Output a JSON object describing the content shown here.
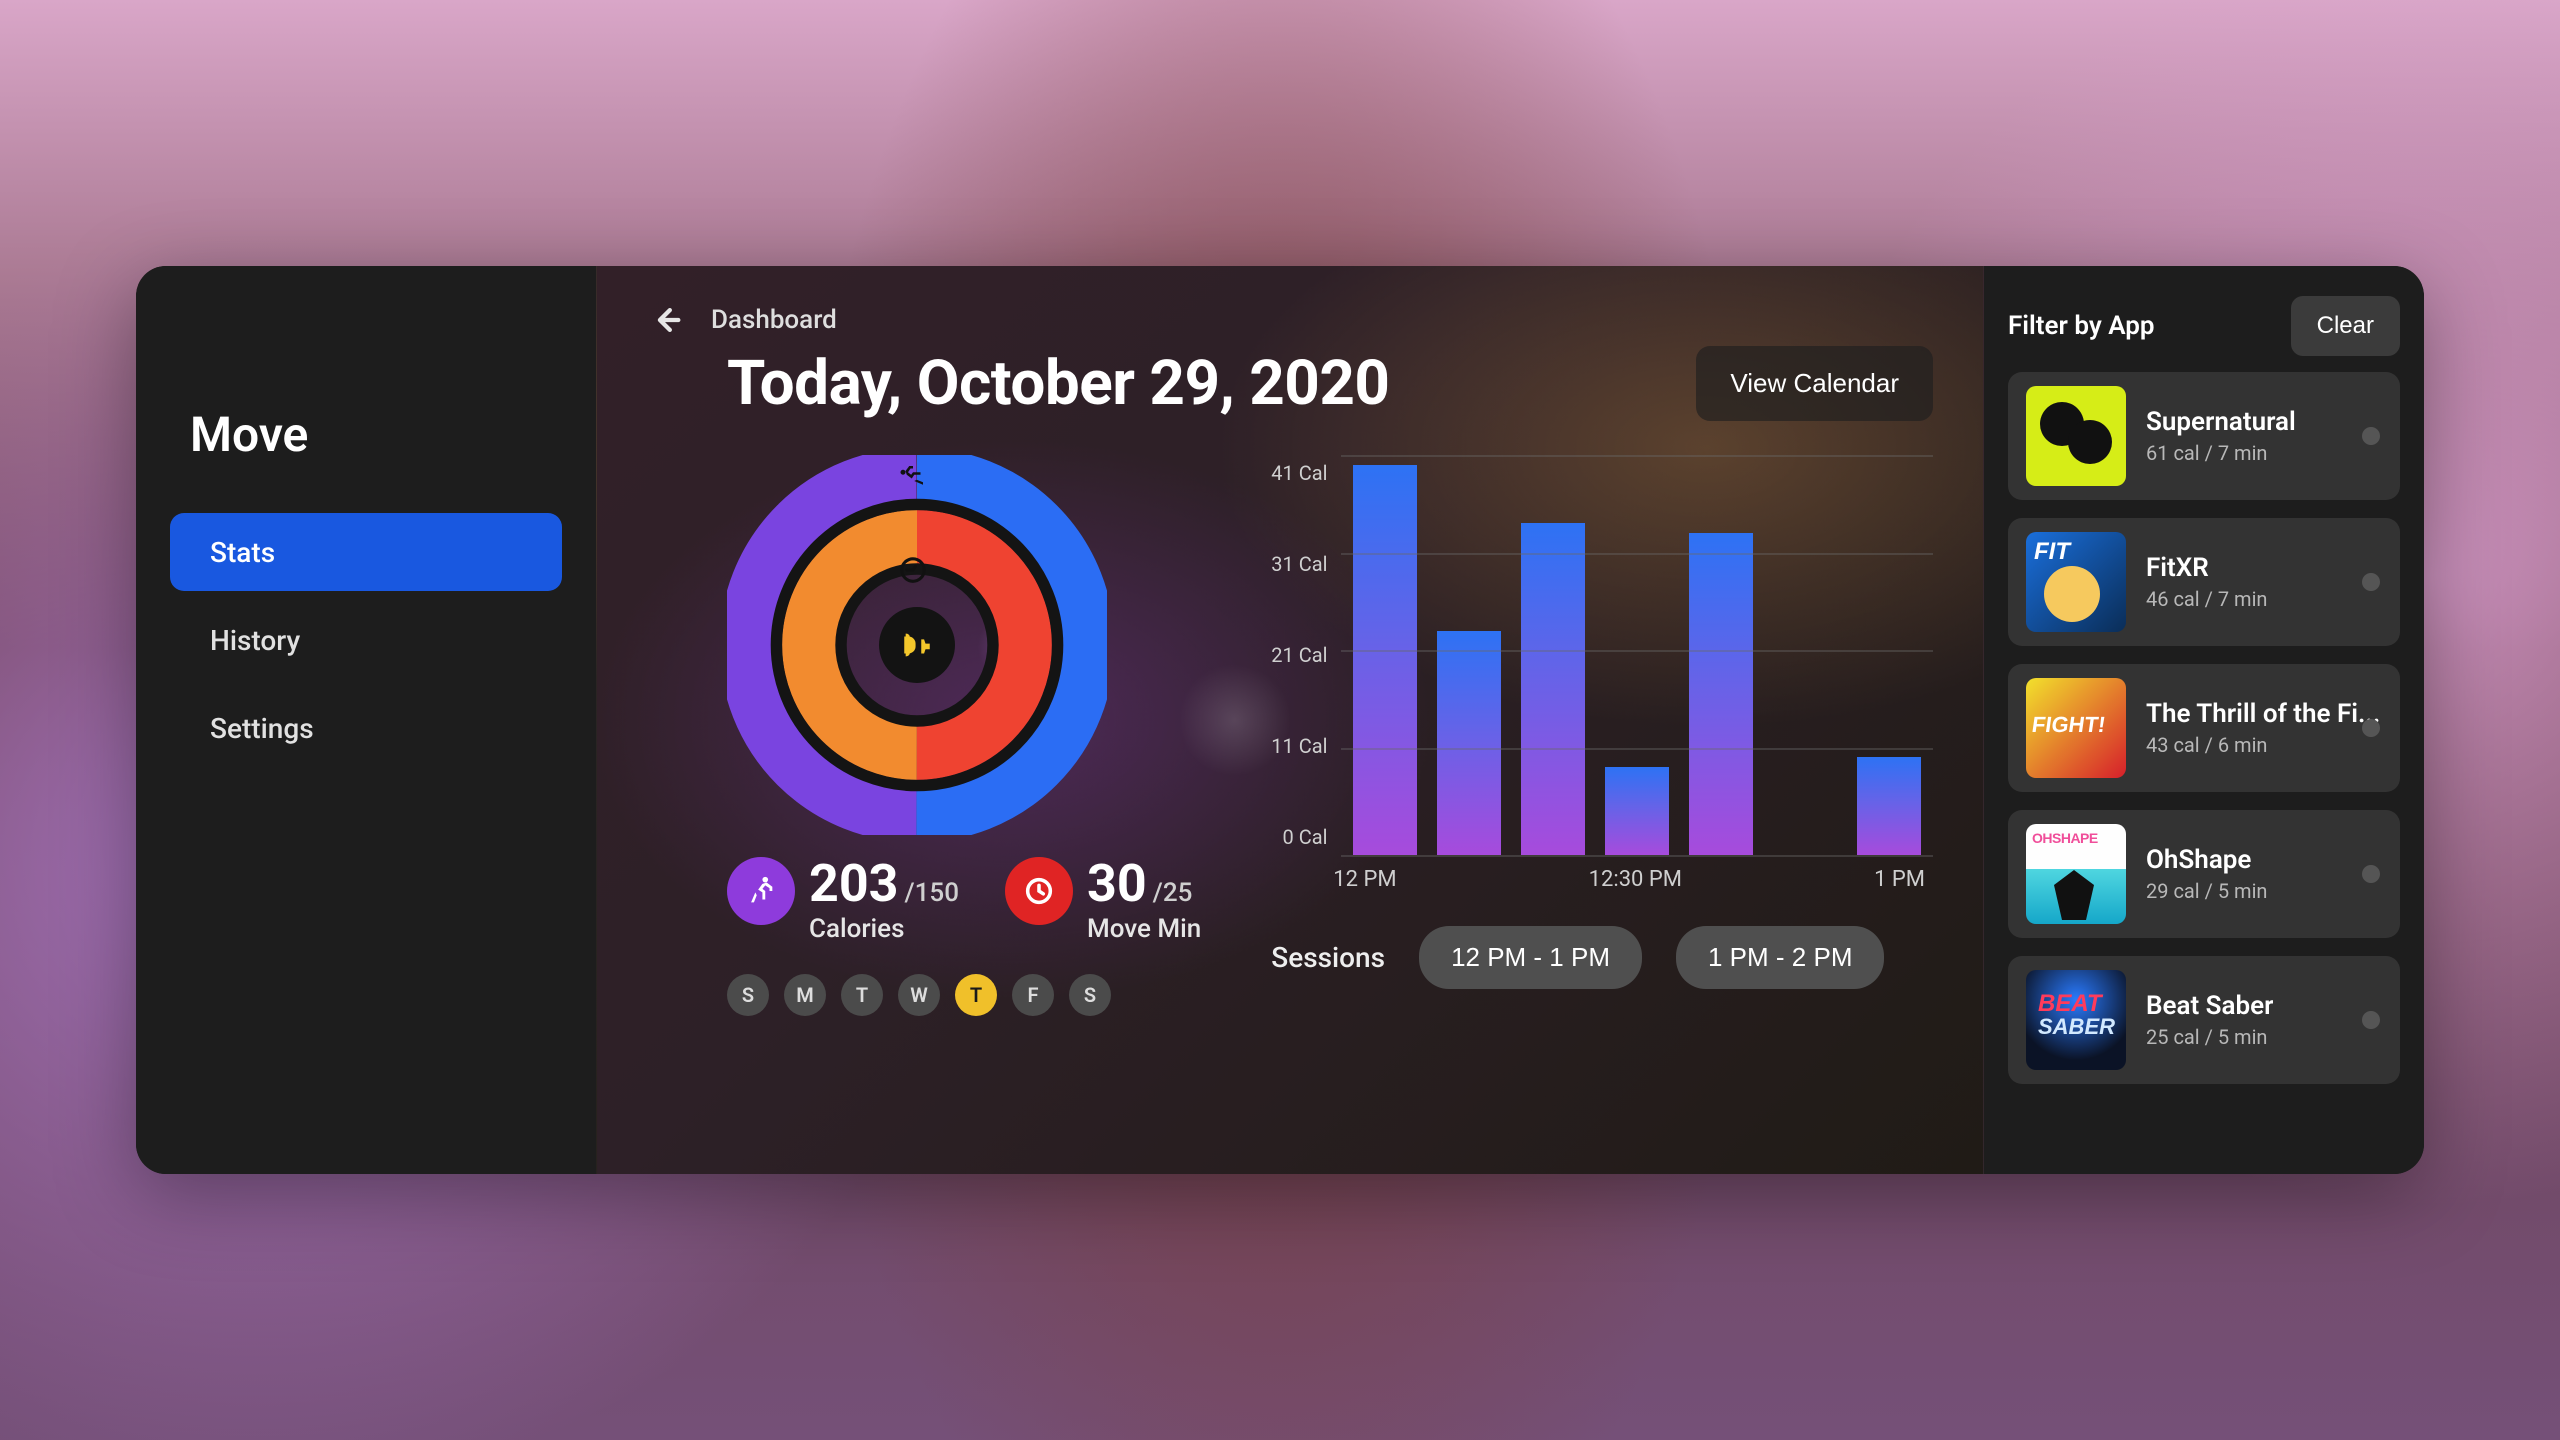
{
  "sidebar": {
    "title": "Move",
    "items": [
      {
        "label": "Stats",
        "active": true
      },
      {
        "label": "History",
        "active": false
      },
      {
        "label": "Settings",
        "active": false
      }
    ]
  },
  "header": {
    "breadcrumb": "Dashboard",
    "title": "Today, October 29, 2020",
    "view_calendar": "View Calendar"
  },
  "rings": {
    "calories": {
      "value": "203",
      "goal": "/150",
      "label": "Calories",
      "progress_frac": 1.0
    },
    "move_min": {
      "value": "30",
      "goal": "/25",
      "label": "Move Min",
      "progress_frac": 1.0
    },
    "trophy": true
  },
  "daychips": [
    "S",
    "M",
    "T",
    "W",
    "T",
    "F",
    "S"
  ],
  "daychip_active_index": 4,
  "sessions": {
    "label": "Sessions",
    "chips": [
      "12 PM - 1 PM",
      "1 PM - 2 PM"
    ]
  },
  "xlabels": [
    "12 PM",
    "12:30 PM",
    "1 PM"
  ],
  "chart_data": {
    "type": "bar",
    "categories": [
      "12:00",
      "12:10",
      "12:20",
      "12:30",
      "12:40",
      "12:50",
      "1:00"
    ],
    "values": [
      40,
      23,
      34,
      9,
      33,
      0,
      10
    ],
    "ylabel": "Cal",
    "ylim": [
      0,
      41
    ],
    "yticks": [
      41,
      31,
      21,
      11,
      0
    ],
    "ytick_labels": [
      "41 Cal",
      "31 Cal",
      "21 Cal",
      "11 Cal",
      "0 Cal"
    ],
    "title": ""
  },
  "filter": {
    "title": "Filter by App",
    "clear": "Clear",
    "apps": [
      {
        "name": "Supernatural",
        "sub": "61 cal / 7 min",
        "thumb": "supernatural"
      },
      {
        "name": "FitXR",
        "sub": "46 cal / 7 min",
        "thumb": "fitxr"
      },
      {
        "name": "The Thrill of the Fi...",
        "sub": "43 cal / 6 min",
        "thumb": "thrill"
      },
      {
        "name": "OhShape",
        "sub": "29 cal / 5 min",
        "thumb": "ohshape"
      },
      {
        "name": "Beat Saber",
        "sub": "25 cal / 5 min",
        "thumb": "beatsaber"
      }
    ]
  }
}
